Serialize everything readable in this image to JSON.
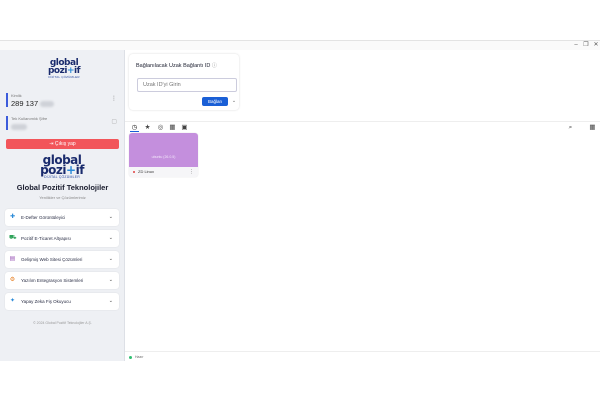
{
  "window": {
    "controls": [
      "–",
      "❐",
      "✕"
    ]
  },
  "sidebar": {
    "logo_small": {
      "word1": "global",
      "word2a": "pozi",
      "word2b": "if",
      "tagline": "DİJİTAL ÇÖZÜMLER"
    },
    "id_block": {
      "label": "Kimlik",
      "value": "289 137"
    },
    "password_block": {
      "label": "Tek Kullanımlık Şifre",
      "value": ""
    },
    "logout_label": "Çıkış yap",
    "logo_big": {
      "word1": "global",
      "word2a": "pozi",
      "word2b": "if",
      "tagline": "DİJİTAL ÇÖZÜMLER"
    },
    "company_name": "Global Pozitif Teknolojiler",
    "company_subtitle": "Yenilikler ve Çözümlerimiz",
    "menu": [
      {
        "label": "E-Defter Görüntüleyici",
        "icon": "plus-icon"
      },
      {
        "label": "Pozitif E-Ticaret Altyapısı",
        "icon": "cart-icon"
      },
      {
        "label": "Gelişmiş Web Sitesi Çözümleri",
        "icon": "document-icon"
      },
      {
        "label": "Yazılım Entegrasyon Sistemleri",
        "icon": "integration-icon"
      },
      {
        "label": "Yapay Zeka Fiş Okuyucu",
        "icon": "star-icon"
      }
    ],
    "copyright": "© 2024 Global Pozitif Teknolojiler A.Ş."
  },
  "connect": {
    "title": "Bağlanılacak Uzak Bağlantı ID",
    "placeholder": "Uzak ID'yi Girin",
    "button_label": "Bağlan"
  },
  "toolbar": {
    "tabs": [
      "history-icon",
      "star-icon",
      "compass-icon",
      "address-book-icon",
      "group-icon"
    ],
    "right": [
      "search-icon",
      "grid-icon"
    ]
  },
  "peer": {
    "thumb_text": "ubuntu (26.0.5)",
    "name": "ZD Linux"
  },
  "status": {
    "text": "Hazır"
  },
  "colors": {
    "accent": "#1a5fd6",
    "logout": "#f2555a",
    "peer_thumb": "#c48fdd",
    "brand_navy": "#1a2b6d"
  }
}
